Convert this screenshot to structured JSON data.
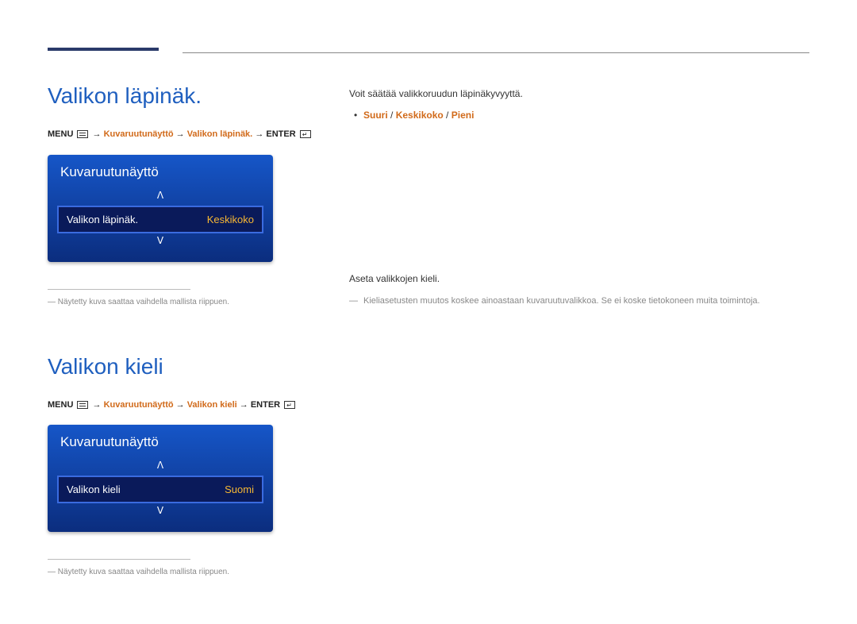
{
  "section1": {
    "title": "Valikon läpinäk.",
    "path": {
      "menu": "MENU",
      "p1": "Kuvaruutunäyttö",
      "p2": "Valikon läpinäk.",
      "enter": "ENTER"
    },
    "osd": {
      "header": "Kuvaruutunäyttö",
      "row_label": "Valikon läpinäk.",
      "row_value": "Keskikoko"
    },
    "footnote": "Näytetty kuva saattaa vaihdella mallista riippuen.",
    "desc": "Voit säätää valikkoruudun läpinäkyvyyttä.",
    "options": {
      "a": "Suuri",
      "b": "Keskikoko",
      "c": "Pieni"
    }
  },
  "section2": {
    "title": "Valikon kieli",
    "path": {
      "menu": "MENU",
      "p1": "Kuvaruutunäyttö",
      "p2": "Valikon kieli",
      "enter": "ENTER"
    },
    "osd": {
      "header": "Kuvaruutunäyttö",
      "row_label": "Valikon kieli",
      "row_value": "Suomi"
    },
    "footnote": "Näytetty kuva saattaa vaihdella mallista riippuen.",
    "desc": "Aseta valikkojen kieli.",
    "note": "Kieliasetusten muutos koskee ainoastaan kuvaruutuvalikkoa. Se ei koske tietokoneen muita toimintoja."
  },
  "arrows": {
    "up": "ᐱ",
    "down": "ᐯ"
  },
  "sep": " / ",
  "pathsep": " → "
}
